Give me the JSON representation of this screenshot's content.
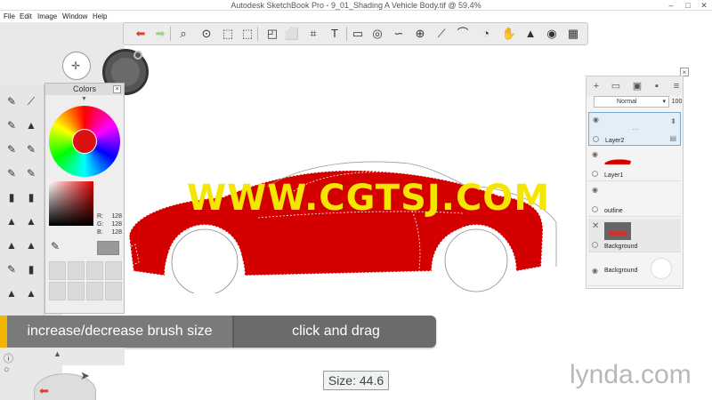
{
  "window": {
    "title": "Autodesk SketchBook Pro - 9_01_Shading A Vehicle Body.tif @ 59.4%",
    "controls": [
      "–",
      "□",
      "✕"
    ]
  },
  "menubar": [
    "File",
    "Edit",
    "Image",
    "Window",
    "Help"
  ],
  "toolbar": {
    "tools": [
      {
        "name": "undo-icon",
        "glyph": "⬅",
        "color": "#e04030"
      },
      {
        "name": "redo-icon",
        "glyph": "➡",
        "color": "#9ccf8a"
      },
      {
        "name": "zoom-icon",
        "glyph": "⌕"
      },
      {
        "name": "lasso-icon",
        "glyph": "⊙"
      },
      {
        "name": "select-rect-icon",
        "glyph": "⬚"
      },
      {
        "name": "crop-select-icon",
        "glyph": "⬚"
      },
      {
        "name": "transform-icon",
        "glyph": "◰"
      },
      {
        "name": "distort-icon",
        "glyph": "⬜"
      },
      {
        "name": "crop-icon",
        "glyph": "⌗"
      },
      {
        "name": "text-icon",
        "glyph": "T"
      },
      {
        "name": "ruler-icon",
        "glyph": "▭"
      },
      {
        "name": "ellipse-icon",
        "glyph": "◎"
      },
      {
        "name": "french-curve-icon",
        "glyph": "∽"
      },
      {
        "name": "perspective-icon",
        "glyph": "⊕"
      },
      {
        "name": "line-icon",
        "glyph": "⟋"
      },
      {
        "name": "curve-icon",
        "glyph": "⌒"
      },
      {
        "name": "fill-icon",
        "glyph": "◔"
      },
      {
        "name": "copic-icon",
        "glyph": "✋"
      },
      {
        "name": "brush-palette-icon",
        "glyph": "▲"
      },
      {
        "name": "color-wheel-icon",
        "glyph": "◉"
      },
      {
        "name": "layer-editor-icon",
        "glyph": "▦"
      }
    ]
  },
  "colors_panel": {
    "title": "Colors",
    "r_label": "R:",
    "r": "128",
    "g_label": "G:",
    "g": "128",
    "b_label": "B:",
    "b": "128",
    "current_color": "#999999",
    "wheel_color": "#dd1111"
  },
  "layers_panel": {
    "blend_mode": "Normal",
    "opacity": "100",
    "layers": [
      {
        "name": "Layer2",
        "selected": true
      },
      {
        "name": "Layer1",
        "selected": false
      },
      {
        "name": "outline",
        "selected": false
      },
      {
        "name": "Background",
        "selected": false
      },
      {
        "name": "Background",
        "selected": false
      }
    ]
  },
  "hint": {
    "left": "increase/decrease brush size",
    "right": "click and drag"
  },
  "size_readout": "Size: 44.6",
  "watermark": "WWW.CGTSJ.COM",
  "brand": "lynda.com",
  "car_color": "#d40000"
}
